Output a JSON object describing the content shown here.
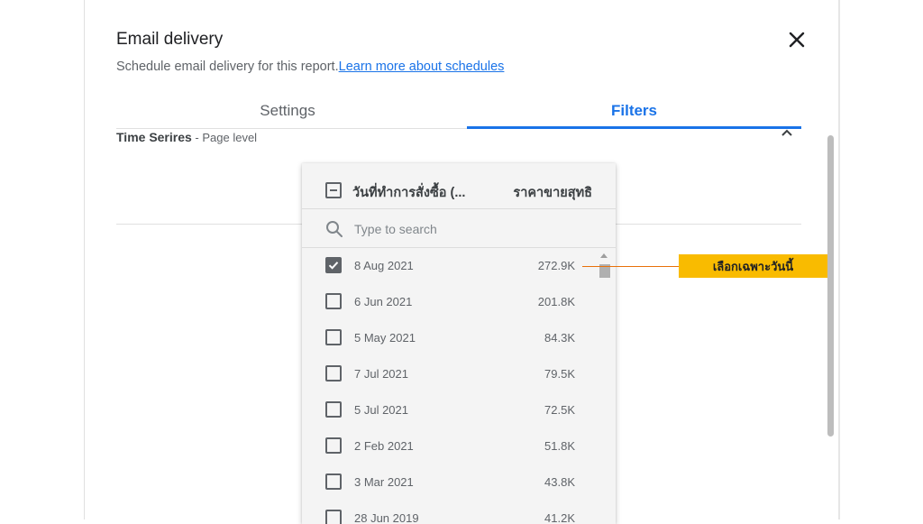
{
  "dialog": {
    "title": "Email delivery",
    "subtitle": "Schedule email delivery for this report.",
    "learn_more": "Learn more about schedules"
  },
  "tabs": [
    {
      "label": "Settings",
      "active": false
    },
    {
      "label": "Filters",
      "active": true
    }
  ],
  "section": {
    "title": "Time Serires",
    "level": " - Page level"
  },
  "dropdown": {
    "dimension_header": "วันที่ทำการสั่งซื้อ (...",
    "metric_header": "ราคาขายสุทธิ",
    "search_placeholder": "Type to search",
    "rows": [
      {
        "label": "8 Aug 2021",
        "value": "272.9K",
        "checked": true
      },
      {
        "label": "6 Jun 2021",
        "value": "201.8K",
        "checked": false
      },
      {
        "label": "5 May 2021",
        "value": "84.3K",
        "checked": false
      },
      {
        "label": "7 Jul 2021",
        "value": "79.5K",
        "checked": false
      },
      {
        "label": "5 Jul 2021",
        "value": "72.5K",
        "checked": false
      },
      {
        "label": "2 Feb 2021",
        "value": "51.8K",
        "checked": false
      },
      {
        "label": "3 Mar 2021",
        "value": "43.8K",
        "checked": false
      },
      {
        "label": "28 Jun 2019",
        "value": "41.2K",
        "checked": false
      }
    ]
  },
  "callout": {
    "text": "เลือกเฉพาะวันนี้"
  },
  "colors": {
    "accent": "#1a73e8",
    "callout": "#f9bb00",
    "callout_line": "#e8710a"
  },
  "icons": {
    "close": "close-icon",
    "search": "search-icon",
    "collapse": "chevron-up-icon"
  }
}
